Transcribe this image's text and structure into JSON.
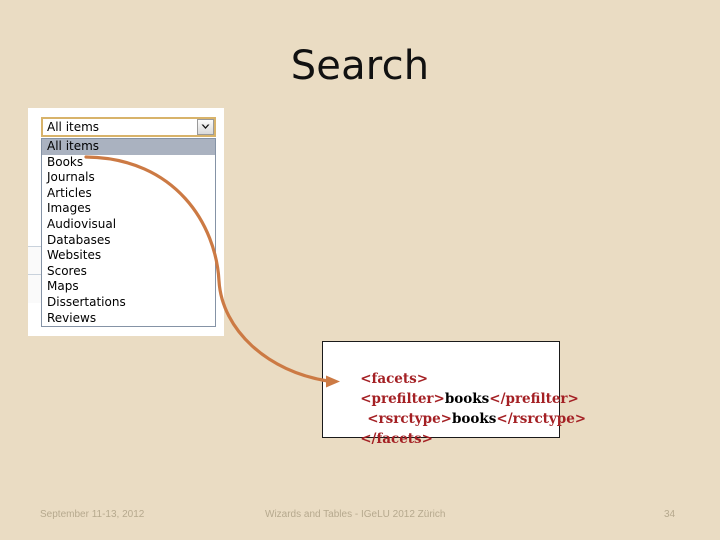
{
  "slide": {
    "title": "Search",
    "background_color": "#EADCC3"
  },
  "search_scope": {
    "selected_value": "All items",
    "arrow_icon": "chevron-down-icon",
    "options": [
      "All items",
      "Books",
      "Journals",
      "Articles",
      "Images",
      "Audiovisual",
      "Databases",
      "Websites",
      "Scores",
      "Maps",
      "Dissertations",
      "Reviews"
    ]
  },
  "xml_callout": {
    "lines": [
      {
        "open_tag": "<facets>",
        "value": "",
        "close_tag": "",
        "indent": 0
      },
      {
        "open_tag": "<prefilter>",
        "value": "books",
        "close_tag": "</prefilter>",
        "indent": 0
      },
      {
        "open_tag": "<rsrctype>",
        "value": "books",
        "close_tag": "</rsrctype>",
        "indent": 1
      },
      {
        "open_tag": "</facets>",
        "value": "",
        "close_tag": "",
        "indent": 0
      }
    ],
    "tag_color": "#A42024",
    "value_color": "#000000"
  },
  "connector": {
    "color": "#CC7A44",
    "arrow_icon": "arrow-right-icon"
  },
  "footer": {
    "date": "September 11-13, 2012",
    "center": "Wizards and Tables - IGeLU 2012 Zürich",
    "page_number": "34"
  }
}
